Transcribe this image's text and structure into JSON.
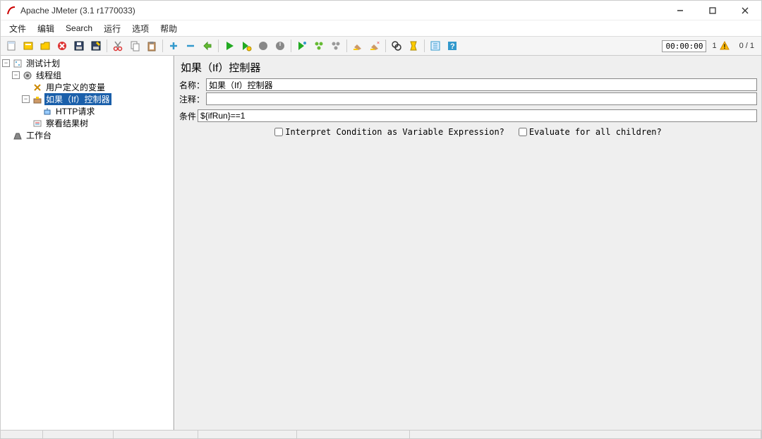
{
  "window": {
    "title": "Apache JMeter (3.1 r1770033)"
  },
  "menu": {
    "file": "文件",
    "edit": "编辑",
    "search": "Search",
    "run": "运行",
    "options": "选项",
    "help": "帮助"
  },
  "toolbar": {
    "time": "00:00:00",
    "warn_count": "1",
    "threads": "0 / 1"
  },
  "tree": {
    "testplan": "测试计划",
    "threadgroup": "线程组",
    "uservars": "用户定义的变量",
    "ifctrl": "如果（If）控制器",
    "httpreq": "HTTP请求",
    "viewresults": "察看结果树",
    "workbench": "工作台"
  },
  "panel": {
    "heading": "如果（If）控制器",
    "name_label": "名称：",
    "name_value": "如果（If）控制器",
    "comment_label": "注释：",
    "comment_value": "",
    "condition_label": "条件",
    "condition_value": "${ifRun}==1",
    "interpret_label": "Interpret Condition as Variable Expression?",
    "evaluate_label": "Evaluate for all children?"
  }
}
